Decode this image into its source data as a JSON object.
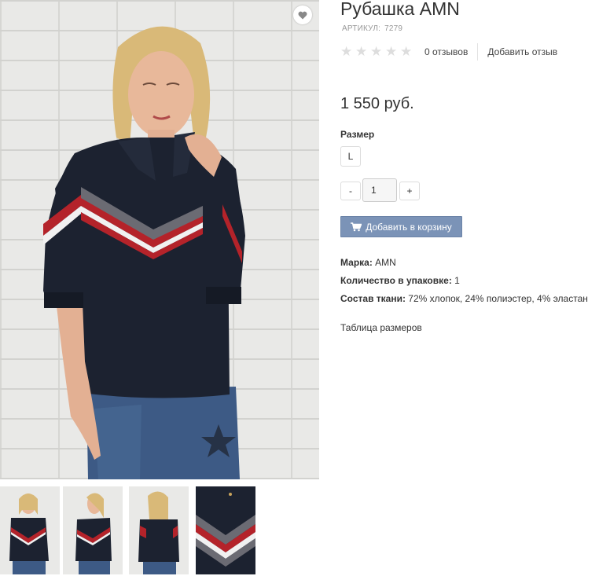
{
  "product": {
    "title": "Рубашка AMN",
    "sku_label": "АРТИКУЛ:",
    "sku_value": "7279",
    "price": "1 550 руб."
  },
  "rating": {
    "stars_filled": 0,
    "stars_total": 5,
    "reviews_count": "0 отзывов",
    "add_review": "Добавить отзыв"
  },
  "size": {
    "label": "Размер",
    "selected": "L"
  },
  "quantity": {
    "minus": "-",
    "value": "1",
    "plus": "+"
  },
  "cart": {
    "button_label": "Добавить в корзину",
    "icon": "cart-icon"
  },
  "attributes": [
    {
      "name": "Марка:",
      "value": "AMN"
    },
    {
      "name": "Количество в упаковке:",
      "value": "1"
    },
    {
      "name": "Состав ткани:",
      "value": "72% хлопок, 24% полиэстер, 4% эластан"
    }
  ],
  "size_table_link": "Таблица размеров",
  "gallery": {
    "favorite_icon": "heart-icon",
    "thumbnails": [
      "thumbnail-front",
      "thumbnail-side",
      "thumbnail-back",
      "thumbnail-detail"
    ]
  },
  "colors": {
    "button_accent": "#7b93b7",
    "shirt": "#1c2230",
    "stripe_red": "#b4232a",
    "stripe_gray": "#6b6b73"
  }
}
